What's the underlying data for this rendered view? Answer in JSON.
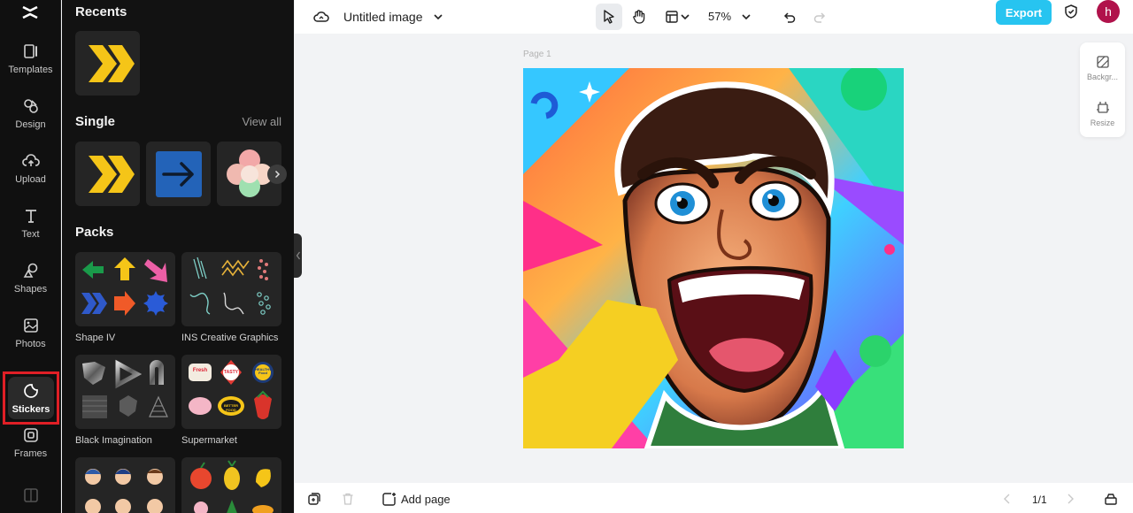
{
  "app": {
    "name": "CapCut"
  },
  "rail": {
    "items": [
      {
        "label": "Templates",
        "icon": "templates-icon"
      },
      {
        "label": "Design",
        "icon": "design-icon"
      },
      {
        "label": "Upload",
        "icon": "upload-icon"
      },
      {
        "label": "Text",
        "icon": "text-icon"
      },
      {
        "label": "Shapes",
        "icon": "shapes-icon"
      },
      {
        "label": "Photos",
        "icon": "photos-icon"
      },
      {
        "label": "Stickers",
        "icon": "stickers-icon",
        "active": true
      },
      {
        "label": "Frames",
        "icon": "frames-icon"
      }
    ]
  },
  "panel": {
    "recents_title": "Recents",
    "single_title": "Single",
    "view_all": "View all",
    "packs_title": "Packs",
    "packs": [
      {
        "label": "Shape IV"
      },
      {
        "label": "INS Creative Graphics"
      },
      {
        "label": "Black Imagination"
      },
      {
        "label": "Supermarket"
      }
    ],
    "supermarket_badges": [
      "Fresh",
      "TASTY",
      "HEALTHY Food",
      "",
      "BETTER FOOD",
      ""
    ]
  },
  "topbar": {
    "title": "Untitled image",
    "zoom": "57%",
    "export_label": "Export",
    "avatar_letter": "h"
  },
  "canvas": {
    "page_label": "Page 1"
  },
  "side_tools": {
    "background_label": "Backgr...",
    "resize_label": "Resize"
  },
  "bottombar": {
    "add_page_label": "Add page",
    "page_count": "1/1"
  },
  "colors": {
    "accent": "#27c4f0",
    "rail_active_border": "#e01f26",
    "avatar_bg": "#b0124b",
    "sticker_yellow": "#f5c518"
  }
}
